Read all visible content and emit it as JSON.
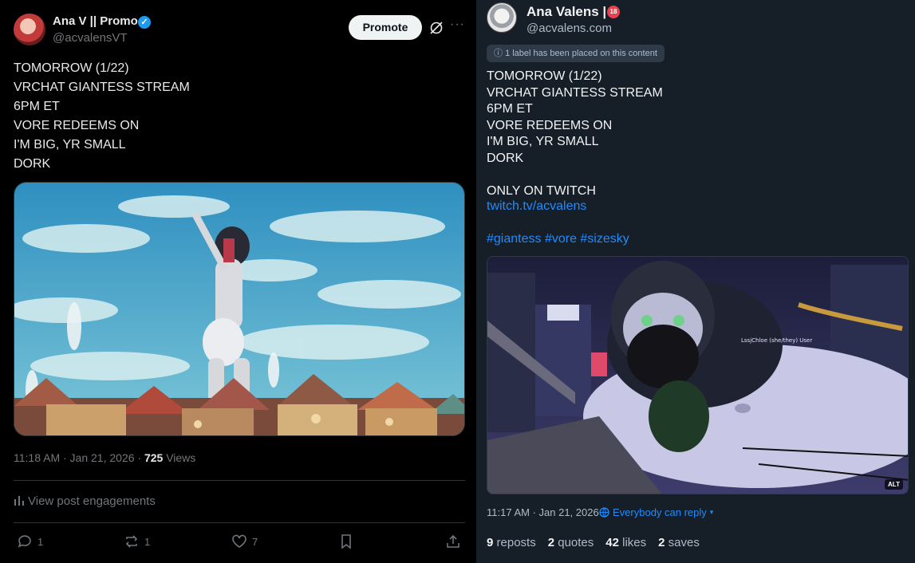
{
  "left_post": {
    "display_name": "Ana V || Promo",
    "handle": "@acvalensVT",
    "promote_label": "Promote",
    "more_label": "···",
    "body": "TOMORROW (1/22)\nVRCHAT GIANTESS STREAM\n6PM ET\nVORE REDEEMS ON\nI'M BIG, YR SMALL\nDORK",
    "timestamp": "11:18 AM · Jan 21, 2026 · ",
    "views_count": "725",
    "views_label": " Views",
    "engagements_label": "View post engagements",
    "actions": {
      "replies": "1",
      "reposts": "1",
      "likes": "7"
    },
    "colors": {
      "accent": "#1d9bf0",
      "muted": "#71767b",
      "text": "#e7e9ea"
    }
  },
  "right_post": {
    "display_name": "Ana Valens |",
    "age_badge": "18",
    "handle": "@acvalens.com",
    "label_notice": "1 label has been placed on this content",
    "body": "TOMORROW (1/22)\nVRCHAT GIANTESS STREAM\n6PM ET\nVORE REDEEMS ON\nI'M BIG, YR SMALL\nDORK\n\nONLY ON TWITCH",
    "link": "twitch.tv/acvalens",
    "hashtags": "#giantess #vore #sizesky",
    "image_overlay_name": "LssjChloe (she/they) User",
    "alt_badge": "ALT",
    "timestamp": "11:17 AM · Jan 21, 2026",
    "reply_setting": "Everybody can reply",
    "stats": [
      {
        "count": "9",
        "label": "reposts"
      },
      {
        "count": "2",
        "label": "quotes"
      },
      {
        "count": "42",
        "label": "likes"
      },
      {
        "count": "2",
        "label": "saves"
      }
    ],
    "colors": {
      "accent": "#208bfe",
      "muted": "#aebbc9",
      "text": "#f1f3f5",
      "background": "#161e27"
    }
  }
}
